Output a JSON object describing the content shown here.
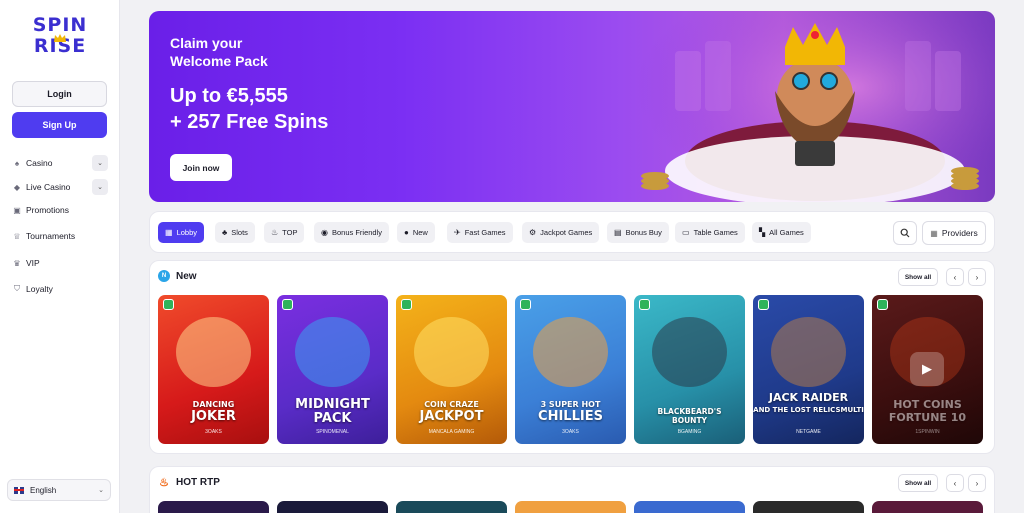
{
  "brand": {
    "line1": "SPIN",
    "line2": "RISE",
    "accent": "#4f3cf0"
  },
  "auth": {
    "login_label": "Login",
    "signup_label": "Sign Up"
  },
  "nav": [
    {
      "label": "Casino",
      "icon": "spade-icon",
      "has_dropdown": true
    },
    {
      "label": "Live Casino",
      "icon": "diamond-icon",
      "has_dropdown": true
    },
    {
      "label": "Promotions",
      "icon": "gift-icon",
      "has_dropdown": false
    },
    {
      "label": "Tournaments",
      "icon": "trophy-icon",
      "has_dropdown": false
    },
    {
      "label": "VIP",
      "icon": "crown-icon",
      "has_dropdown": false
    },
    {
      "label": "Loyalty",
      "icon": "shield-icon",
      "has_dropdown": false
    }
  ],
  "language": {
    "label": "English"
  },
  "banner": {
    "line1": "Claim your",
    "line2": "Welcome Pack",
    "amount1": "Up to €5,555",
    "amount2": "+ 257 Free Spins",
    "cta": "Join now"
  },
  "tabs": [
    {
      "label": "Lobby",
      "icon": "lobby-icon"
    },
    {
      "label": "Slots",
      "icon": "cherry-icon"
    },
    {
      "label": "TOP",
      "icon": "fire-icon"
    },
    {
      "label": "Bonus Friendly",
      "icon": "bag-icon"
    },
    {
      "label": "New",
      "icon": "new-icon"
    },
    {
      "label": "Fast Games",
      "icon": "plane-icon"
    },
    {
      "label": "Jackpot Games",
      "icon": "jackpot-icon"
    },
    {
      "label": "Bonus Buy",
      "icon": "cart-icon"
    },
    {
      "label": "Table Games",
      "icon": "table-icon"
    },
    {
      "label": "All Games",
      "icon": "grid-icon"
    }
  ],
  "providers_label": "Providers",
  "sections": {
    "new": {
      "title": "New",
      "show_all": "Show all",
      "games": [
        {
          "t1": "DANCING",
          "t2": "JOKER",
          "provider": "3OAKS"
        },
        {
          "t1": "MIDNIGHT",
          "t2": "PACK",
          "provider": "SPINOMENAL"
        },
        {
          "t1": "COIN CRAZE",
          "t2": "JACKPOT",
          "provider": "MANCALA GAMING"
        },
        {
          "t1": "3 SUPER HOT",
          "t2": "CHILLIES",
          "provider": "3OAKS"
        },
        {
          "t1": "BLACKBEARD'S",
          "t2": "BOUNTY",
          "provider": "BGAMING"
        },
        {
          "t1": "JACK RAIDER",
          "t2": "AND THE LOST RELICSMULTI",
          "provider": "NETGAME"
        },
        {
          "t1": "HOT COINS",
          "t2": "FORTUNE 10",
          "provider": "1SPINWIN"
        }
      ]
    },
    "hot": {
      "title": "HOT RTP",
      "show_all": "Show all"
    }
  }
}
